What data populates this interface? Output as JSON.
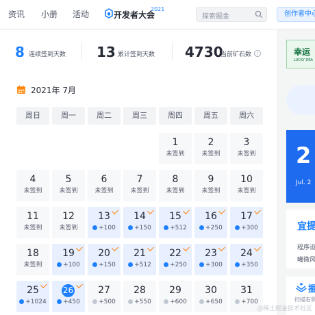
{
  "nav": {
    "items": [
      "资讯",
      "小册",
      "活动"
    ],
    "brand": "开发者大会",
    "brand_year": "2021",
    "search_placeholder": "探索掘金",
    "creator_button": "创作者中心"
  },
  "stats": [
    {
      "value": "8",
      "label": "连续签到天数"
    },
    {
      "value": "13",
      "label": "累计签到天数"
    },
    {
      "value": "4730",
      "label": "当前矿石数"
    }
  ],
  "calendar": {
    "month_title": "2021年 7月",
    "weekdays": [
      "周日",
      "周一",
      "周二",
      "周三",
      "周四",
      "周五",
      "周六"
    ],
    "weeks": [
      [
        null,
        null,
        null,
        null,
        {
          "day": "1",
          "text": "未签到",
          "state": "unsigned"
        },
        {
          "day": "2",
          "text": "未签到",
          "state": "unsigned"
        },
        {
          "day": "3",
          "text": "未签到",
          "state": "unsigned"
        }
      ],
      [
        {
          "day": "4",
          "text": "未签到",
          "state": "unsigned"
        },
        {
          "day": "5",
          "text": "未签到",
          "state": "unsigned"
        },
        {
          "day": "6",
          "text": "未签到",
          "state": "unsigned"
        },
        {
          "day": "7",
          "text": "未签到",
          "state": "unsigned"
        },
        {
          "day": "8",
          "text": "未签到",
          "state": "unsigned"
        },
        {
          "day": "9",
          "text": "未签到",
          "state": "unsigned"
        },
        {
          "day": "10",
          "text": "未签到",
          "state": "unsigned"
        }
      ],
      [
        {
          "day": "11",
          "text": "未签到",
          "state": "unsigned"
        },
        {
          "day": "12",
          "text": "未签到",
          "state": "unsigned"
        },
        {
          "day": "13",
          "text": "+100",
          "state": "signed"
        },
        {
          "day": "14",
          "text": "+150",
          "state": "signed"
        },
        {
          "day": "15",
          "text": "+512",
          "state": "signed"
        },
        {
          "day": "16",
          "text": "+250",
          "state": "signed"
        },
        {
          "day": "17",
          "text": "+300",
          "state": "signed"
        }
      ],
      [
        {
          "day": "18",
          "text": "未签到",
          "state": "unsigned"
        },
        {
          "day": "19",
          "text": "+100",
          "state": "signed"
        },
        {
          "day": "20",
          "text": "+150",
          "state": "signed"
        },
        {
          "day": "21",
          "text": "+512",
          "state": "signed"
        },
        {
          "day": "22",
          "text": "+250",
          "state": "signed"
        },
        {
          "day": "23",
          "text": "+300",
          "state": "signed"
        },
        {
          "day": "24",
          "text": "+350",
          "state": "signed"
        }
      ],
      [
        {
          "day": "25",
          "text": "+1024",
          "state": "signed"
        },
        {
          "day": "26",
          "text": "+450",
          "state": "today"
        },
        {
          "day": "27",
          "text": "+500",
          "state": "future"
        },
        {
          "day": "28",
          "text": "+550",
          "state": "future"
        },
        {
          "day": "29",
          "text": "+600",
          "state": "future"
        },
        {
          "day": "30",
          "text": "+650",
          "state": "future"
        },
        {
          "day": "31",
          "text": "+700",
          "state": "future"
        }
      ]
    ]
  },
  "sidebar": {
    "lucky_title": "幸运",
    "lucky_sub": "LUCKY DRA",
    "promo_num": "2",
    "promo_date": "Jul. 2",
    "tips_title": "宜提",
    "tips_line1": "程序设",
    "tips_line2": "曦微风",
    "juejin_text": "掘",
    "juejin_sub": "扫描右侧"
  },
  "watermark": "@稀土掘金技术社区",
  "colors": {
    "accent": "#1e80ff",
    "signed_bg": "#e8f0ff",
    "check": "#ff7d00"
  }
}
